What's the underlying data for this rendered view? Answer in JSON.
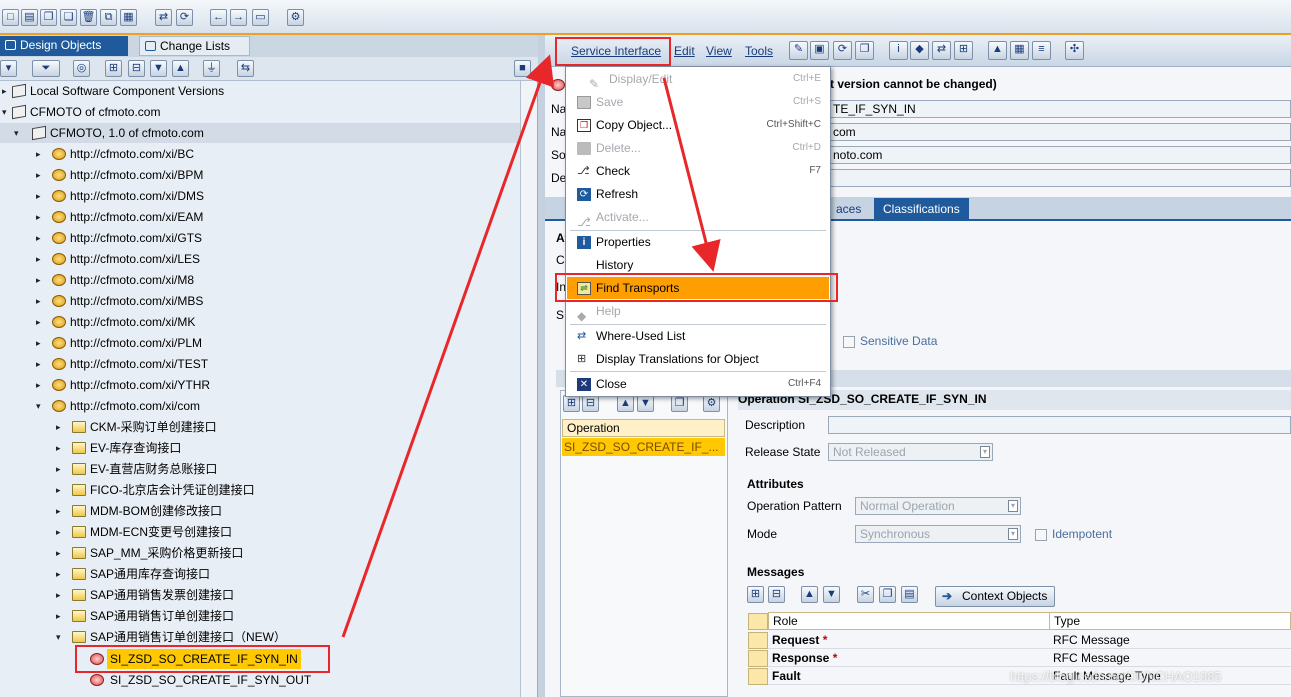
{
  "left": {
    "tabs": [
      "Design Objects",
      "Change Lists"
    ],
    "tree": [
      {
        "label": "Local Software Component Versions"
      },
      {
        "label": "CFMOTO of cfmoto.com"
      },
      {
        "label": "CFMOTO, 1.0 of cfmoto.com"
      },
      {
        "label": "http://cfmoto.com/xi/BC"
      },
      {
        "label": "http://cfmoto.com/xi/BPM"
      },
      {
        "label": "http://cfmoto.com/xi/DMS"
      },
      {
        "label": "http://cfmoto.com/xi/EAM"
      },
      {
        "label": "http://cfmoto.com/xi/GTS"
      },
      {
        "label": "http://cfmoto.com/xi/LES"
      },
      {
        "label": "http://cfmoto.com/xi/M8"
      },
      {
        "label": "http://cfmoto.com/xi/MBS"
      },
      {
        "label": "http://cfmoto.com/xi/MK"
      },
      {
        "label": "http://cfmoto.com/xi/PLM"
      },
      {
        "label": "http://cfmoto.com/xi/TEST"
      },
      {
        "label": "http://cfmoto.com/xi/YTHR"
      },
      {
        "label": "http://cfmoto.com/xi/com"
      },
      {
        "label": "CKM-采购订单创建接口"
      },
      {
        "label": "EV-库存查询接口"
      },
      {
        "label": "EV-直营店财务总账接口"
      },
      {
        "label": "FICO-北京店会计凭证创建接口"
      },
      {
        "label": "MDM-BOM创建修改接口"
      },
      {
        "label": "MDM-ECN变更号创建接口"
      },
      {
        "label": "SAP_MM_采购价格更新接口"
      },
      {
        "label": "SAP通用库存查询接口"
      },
      {
        "label": "SAP通用销售发票创建接口"
      },
      {
        "label": "SAP通用销售订单创建接口"
      },
      {
        "label": "SAP通用销售订单创建接口（NEW）"
      },
      {
        "label": "SI_ZSD_SO_CREATE_IF_SYN_IN"
      },
      {
        "label": "SI_ZSD_SO_CREATE_IF_SYN_OUT"
      }
    ]
  },
  "menubar": {
    "items": [
      "Service Interface",
      "Edit",
      "View",
      "Tools"
    ]
  },
  "dropdown": {
    "items": [
      {
        "label": "Display/Edit",
        "shortcut": "Ctrl+E"
      },
      {
        "label": "Save",
        "shortcut": "Ctrl+S"
      },
      {
        "label": "Copy Object...",
        "shortcut": "Ctrl+Shift+C"
      },
      {
        "label": "Delete...",
        "shortcut": "Ctrl+D"
      },
      {
        "label": "Check",
        "shortcut": "F7"
      },
      {
        "label": "Refresh",
        "shortcut": ""
      },
      {
        "label": "Activate...",
        "shortcut": ""
      },
      {
        "label": "Properties",
        "shortcut": ""
      },
      {
        "label": "History",
        "shortcut": ""
      },
      {
        "label": "Find Transports",
        "shortcut": ""
      },
      {
        "label": "Help",
        "shortcut": ""
      },
      {
        "label": "Where-Used List",
        "shortcut": ""
      },
      {
        "label": "Display Translations for Object",
        "shortcut": ""
      },
      {
        "label": "Close",
        "shortcut": "Ctrl+F4"
      }
    ]
  },
  "header": {
    "notice_partial": "t version cannot be changed)",
    "name_partial": "TE_IF_SYN_IN",
    "namespace_partial": "com",
    "swc_partial": "noto.com",
    "row_labels": [
      "Na",
      "Na",
      "So",
      "De"
    ],
    "tabs": [
      "aces",
      "Classifications"
    ]
  },
  "attributes_partial": {
    "labels": [
      "At",
      "C",
      "In",
      "S"
    ],
    "sensitive_data": "Sensitive Data"
  },
  "operation": {
    "list_header": "Operation",
    "list_item": "SI_ZSD_SO_CREATE_IF_...",
    "title": "Operation SI_ZSD_SO_CREATE_IF_SYN_IN",
    "description_label": "Description",
    "description_value": "",
    "release_state_label": "Release State",
    "release_state_value": "Not Released",
    "attributes_title": "Attributes",
    "pattern_label": "Operation Pattern",
    "pattern_value": "Normal Operation",
    "mode_label": "Mode",
    "mode_value": "Synchronous",
    "idempotent_label": "Idempotent",
    "messages_title": "Messages",
    "context_objects": "Context Objects",
    "columns": [
      "Role",
      "Type"
    ],
    "rows": [
      {
        "role": "Request",
        "req": "*",
        "type": "RFC Message"
      },
      {
        "role": "Response",
        "req": "*",
        "type": "RFC Message"
      },
      {
        "role": "Fault",
        "req": "",
        "type": "Fault Message Type"
      }
    ]
  },
  "watermark": "https://blog.csdn.net/JUNCHAO1985",
  "colors": {
    "accent": "#1f5a9c",
    "selection": "#ffc800",
    "highlight_menu": "#ff9e00",
    "annotation": "#e8272a"
  }
}
